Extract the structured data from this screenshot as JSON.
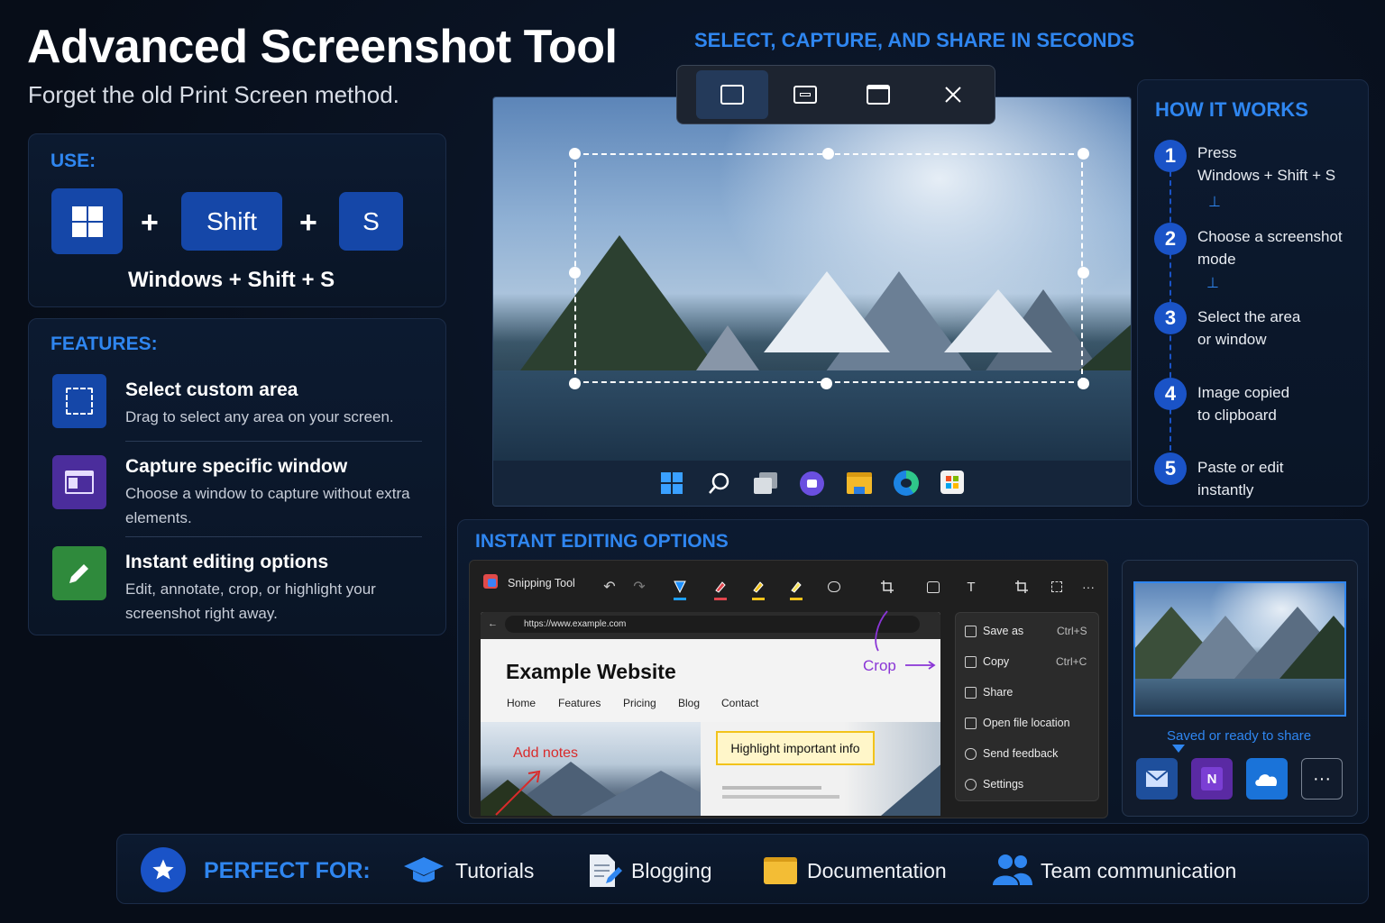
{
  "header": {
    "title": "Advanced Screenshot Tool",
    "subtitle": "Forget the old Print Screen method.",
    "tagline": "SELECT, CAPTURE, AND SHARE IN SECONDS"
  },
  "use": {
    "heading": "USE:",
    "keys": [
      "Shift",
      "S"
    ],
    "plus": "+",
    "combo": "Windows + Shift + S"
  },
  "features": {
    "heading": "FEATURES:",
    "items": [
      {
        "title": "Select custom area",
        "desc": "Drag to select any area on your screen.",
        "icon": "dashed-select-icon",
        "color": "#1547a8"
      },
      {
        "title": "Capture specific window",
        "desc": "Choose a window to capture without extra elements.",
        "icon": "window-icon",
        "color": "#4b2d9c"
      },
      {
        "title": "Instant editing options",
        "desc": "Edit, annotate, crop, or highlight your screenshot right away.",
        "icon": "pencil-icon",
        "color": "#2f8a3c"
      }
    ]
  },
  "capture_toolbar": {
    "modes": [
      "rectangle-mode-icon",
      "freeform-mode-icon",
      "window-mode-icon"
    ],
    "close": "close-icon"
  },
  "taskbar": {
    "icons": [
      "start-icon",
      "search-icon",
      "task-view-icon",
      "chat-icon",
      "file-explorer-icon",
      "edge-icon",
      "store-icon"
    ]
  },
  "how_it_works": {
    "heading": "HOW IT WORKS",
    "steps": [
      {
        "num": "1",
        "line1": "Press",
        "line2": "Windows + Shift + S"
      },
      {
        "num": "2",
        "line1": "Choose a screenshot",
        "line2": "mode"
      },
      {
        "num": "3",
        "line1": "Select the area",
        "line2": "or window"
      },
      {
        "num": "4",
        "line1": "Image copied",
        "line2": "to clipboard"
      },
      {
        "num": "5",
        "line1": "Paste or edit",
        "line2": "instantly"
      }
    ]
  },
  "editing": {
    "heading": "INSTANT EDITING OPTIONS",
    "app_name": "Snipping Tool",
    "url": "https://www.example.com",
    "site_title": "Example Website",
    "nav": [
      "Home",
      "Features",
      "Pricing",
      "Blog",
      "Contact"
    ],
    "crop_label": "Crop",
    "notes_label": "Add notes",
    "highlight_label": "Highlight important info",
    "menu": [
      {
        "label": "Save as",
        "shortcut": "Ctrl+S"
      },
      {
        "label": "Copy",
        "shortcut": "Ctrl+C"
      },
      {
        "label": "Share",
        "shortcut": ""
      },
      {
        "label": "Open file location",
        "shortcut": ""
      },
      {
        "label": "Send feedback",
        "shortcut": ""
      },
      {
        "label": "Settings",
        "shortcut": ""
      }
    ]
  },
  "share": {
    "caption": "Saved or ready to share",
    "targets": [
      "mail-icon",
      "onenote-icon",
      "onedrive-icon",
      "more-icon"
    ],
    "onenote_letter": "N",
    "more": "···"
  },
  "perfect_for": {
    "heading": "PERFECT FOR:",
    "items": [
      {
        "label": "Tutorials",
        "icon": "graduation-cap-icon"
      },
      {
        "label": "Blogging",
        "icon": "document-pen-icon"
      },
      {
        "label": "Documentation",
        "icon": "folder-icon"
      },
      {
        "label": "Team communication",
        "icon": "people-icon"
      }
    ]
  },
  "colors": {
    "accent": "#2f86f0",
    "key_blue": "#1547a8",
    "highlight": "#f2c31b",
    "note_red": "#d92b2b",
    "crop_purple": "#8a35d6"
  }
}
